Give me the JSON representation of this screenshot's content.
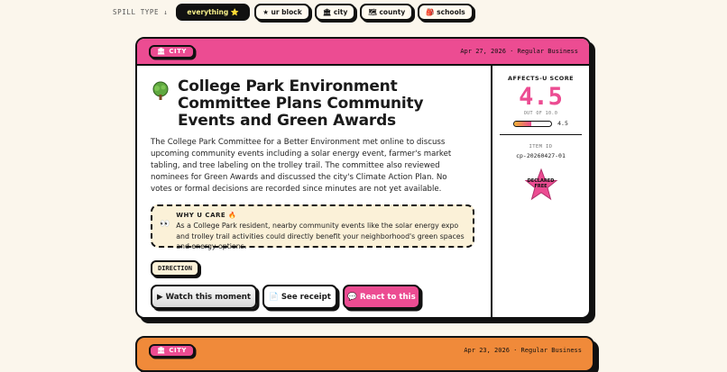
{
  "filters": {
    "label": "SPILL TYPE ↓",
    "chips": [
      {
        "label": "everything ⭐",
        "active": true
      },
      {
        "label": "★ ur block",
        "active": false
      },
      {
        "label": "🏛 city",
        "active": false
      },
      {
        "label": "🗺 county",
        "active": false
      },
      {
        "label": "🎒 schools",
        "active": false
      }
    ]
  },
  "card": {
    "tag": "CITY",
    "date": "Apr 27, 2026 · Regular Business",
    "title": "College Park Environment Committee Plans Community Events and Green Awards",
    "summary": "The College Park Committee for a Better Environment met online to discuss upcoming community events including a solar energy event, farmer's market tabling, and tree labeling on the trolley trail. The committee also reviewed nominees for Green Awards and discussed the city's Climate Action Plan. No votes or formal decisions are recorded since minutes are not yet available.",
    "why": {
      "title": "WHY U CARE 🔥",
      "text": "As a College Park resident, nearby community events like the solar energy expo and trolley trail activities could directly benefit your neighborhood's green spaces and energy options."
    },
    "direction_label": "DIRECTION",
    "buttons": {
      "watch": "▶ Watch this moment",
      "receipt": "📄 See receipt",
      "react": "💬 React to this"
    },
    "side": {
      "score_label": "AFFECTS-U SCORE",
      "score": "4.5",
      "out_of": "OUT OF 10.0",
      "meter_value": "4.5",
      "meter_fraction": 0.45,
      "item_label": "ITEM ID",
      "item_id": "cp-20260427-01",
      "badge": "DECLARED FREE"
    }
  },
  "next_card": {
    "tag": "CITY",
    "date": "Apr 23, 2026 · Regular Business"
  },
  "colors": {
    "accent_pink": "#ec4c92",
    "accent_orange": "#f08a3a",
    "background": "#fbf6ec"
  }
}
